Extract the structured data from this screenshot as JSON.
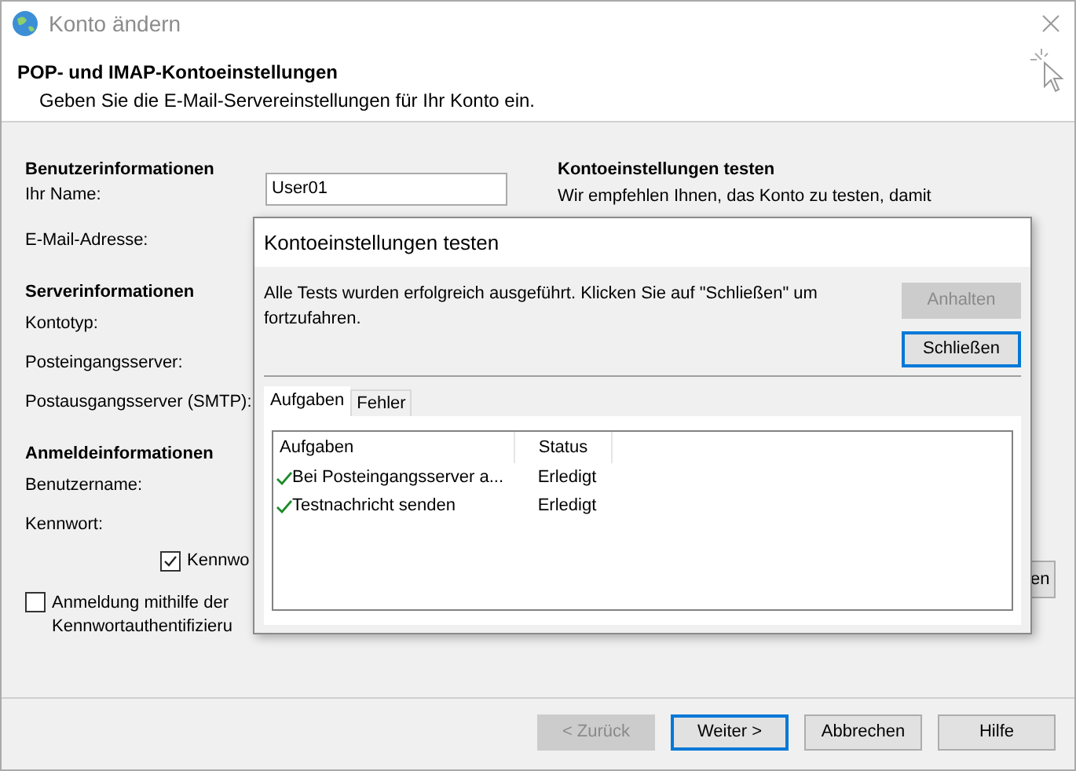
{
  "window": {
    "title": "Konto ändern"
  },
  "header": {
    "title": "POP- und IMAP-Kontoeinstellungen",
    "subtitle": "Geben Sie die E-Mail-Servereinstellungen für Ihr Konto ein."
  },
  "sections": [
    {
      "heading": "Benutzerinformationen",
      "rows": [
        {
          "kind": "field",
          "label": "Ihr Name:",
          "value": "User01"
        },
        {
          "kind": "label",
          "label": "E-Mail-Adresse:"
        }
      ]
    },
    {
      "heading": "Serverinformationen",
      "rows": [
        {
          "kind": "label",
          "label": "Kontotyp:"
        },
        {
          "kind": "label",
          "label": "Posteingangsserver:"
        },
        {
          "kind": "label",
          "label": "Postausgangsserver (SMTP):"
        }
      ]
    },
    {
      "heading": "Anmeldeinformationen",
      "rows": [
        {
          "kind": "label",
          "label": "Benutzername:"
        },
        {
          "kind": "label",
          "label": "Kennwort:"
        },
        {
          "kind": "checkbox",
          "label": "Kennwo",
          "checked": true
        }
      ]
    }
  ],
  "spa_option": {
    "lines": [
      "Anmeldung mithilfe der",
      "Kennwortauthentifizieru"
    ],
    "checked": false
  },
  "test_panel": {
    "heading": "Kontoeinstellungen testen",
    "text": "Wir empfehlen Ihnen, das Konto zu testen, damit",
    "button": "en"
  },
  "footer_buttons": [
    {
      "label": "< Zurück",
      "disabled": true,
      "default": false
    },
    {
      "label": "Weiter >",
      "disabled": false,
      "default": true
    },
    {
      "label": "Abbrechen",
      "disabled": false,
      "default": false
    },
    {
      "label": "Hilfe",
      "disabled": false,
      "default": false
    }
  ],
  "dialog": {
    "title": "Kontoeinstellungen testen",
    "message": "Alle Tests wurden erfolgreich ausgeführt. Klicken Sie auf \"Schließen\" um fortzufahren.",
    "buttons": [
      {
        "label": "Anhalten",
        "disabled": true,
        "default": false
      },
      {
        "label": "Schließen",
        "disabled": false,
        "default": true
      }
    ],
    "tabs": [
      {
        "label": "Aufgaben",
        "selected": true
      },
      {
        "label": "Fehler",
        "selected": false
      }
    ],
    "table": {
      "columns": [
        "Aufgaben",
        "Status"
      ],
      "rows": [
        {
          "task": "Bei Posteingangsserver a...",
          "status": "Erledigt",
          "done": true
        },
        {
          "task": "Testnachricht senden",
          "status": "Erledigt",
          "done": true
        }
      ]
    }
  }
}
